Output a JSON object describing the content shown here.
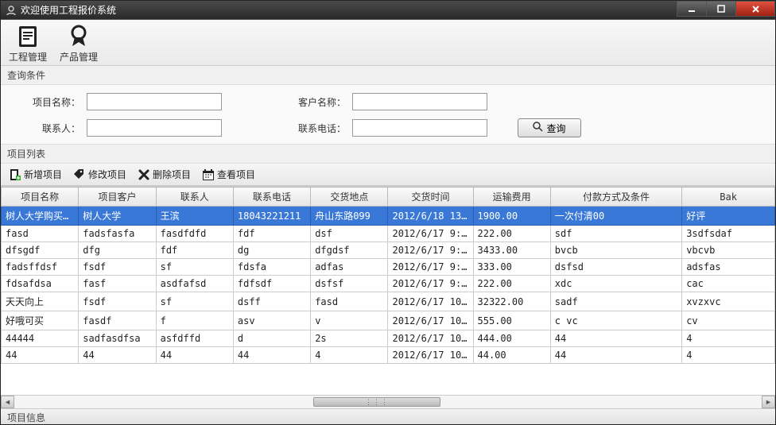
{
  "window": {
    "title": "欢迎使用工程报价系统"
  },
  "ribbon": {
    "items": [
      {
        "label": "工程管理"
      },
      {
        "label": "产品管理"
      }
    ]
  },
  "search": {
    "section_label": "查询条件",
    "project_name_label": "项目名称：",
    "customer_name_label": "客户名称：",
    "contact_label": "联系人：",
    "phone_label": "联系电话：",
    "project_name_value": "",
    "customer_name_value": "",
    "contact_value": "",
    "phone_value": "",
    "search_button": "查询"
  },
  "list": {
    "section_label": "项目列表",
    "toolbar": {
      "add": "新增项目",
      "edit": "修改项目",
      "delete": "删除项目",
      "view": "查看项目"
    },
    "columns": [
      "项目名称",
      "项目客户",
      "联系人",
      "联系电话",
      "交货地点",
      "交货时间",
      "运输费用",
      "付款方式及条件",
      "Bak"
    ],
    "rows": [
      {
        "selected": true,
        "cells": [
          "树人大学购买...",
          "树人大学",
          "王滨",
          "18043221211",
          "舟山东路099",
          "2012/6/18 13...",
          "1900.00",
          "一次付清00",
          "好评"
        ]
      },
      {
        "selected": false,
        "cells": [
          "fasd",
          "fadsfasfa",
          "fasdfdfd",
          "fdf",
          "dsf",
          "2012/6/17 9:...",
          "222.00",
          "sdf",
          "3sdfsdaf"
        ]
      },
      {
        "selected": false,
        "cells": [
          "dfsgdf",
          "dfg",
          "fdf",
          "dg",
          "dfgdsf",
          "2012/6/17 9:...",
          "3433.00",
          "bvcb",
          "vbcvb"
        ]
      },
      {
        "selected": false,
        "cells": [
          "fadsffdsf",
          "fsdf",
          "sf",
          "fdsfa",
          "adfas",
          "2012/6/17 9:...",
          "333.00",
          "dsfsd",
          "adsfas"
        ]
      },
      {
        "selected": false,
        "cells": [
          "fdsafdsa",
          "fasf",
          "asdfafsd",
          "fdfsdf",
          "dsfsf",
          "2012/6/17 9:...",
          "222.00",
          "xdc",
          "cac"
        ]
      },
      {
        "selected": false,
        "cells": [
          "天天向上",
          "fsdf",
          "sf",
          "dsff",
          "fasd",
          "2012/6/17 10...",
          "32322.00",
          "sadf",
          "xvzxvc"
        ]
      },
      {
        "selected": false,
        "cells": [
          "好哦可买",
          "fasdf",
          "f",
          "asv",
          "v",
          "2012/6/17 10...",
          "555.00",
          "c  vc",
          "cv"
        ]
      },
      {
        "selected": false,
        "cells": [
          "44444",
          "sadfasdfsa",
          "asfdffd",
          "d",
          "2s",
          "2012/6/17 10...",
          "444.00",
          "44",
          "4"
        ]
      },
      {
        "selected": false,
        "cells": [
          "44",
          "44",
          "44",
          "44",
          "4",
          "2012/6/17 10...",
          "44.00",
          "44",
          "4"
        ]
      }
    ]
  },
  "status": {
    "label": "项目信息"
  }
}
